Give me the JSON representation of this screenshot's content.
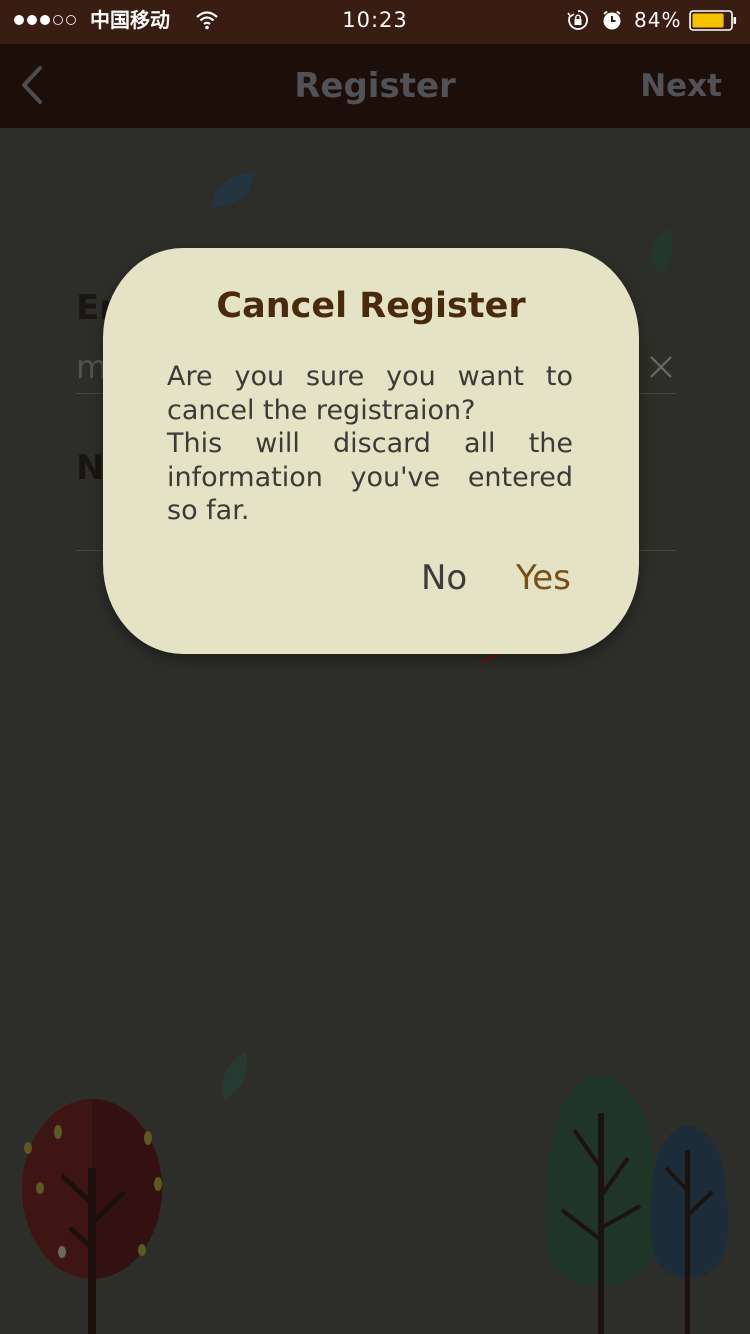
{
  "status_bar": {
    "carrier": "中国移动",
    "time": "10:23",
    "battery_percent": "84%",
    "signal_icon": "signal-dots-icon",
    "wifi_icon": "wifi-icon",
    "orientation_lock_icon": "rotation-lock-icon",
    "alarm_icon": "alarm-clock-icon",
    "battery_icon": "battery-icon",
    "battery_level": 0.84,
    "battery_color": "#f6c200"
  },
  "nav": {
    "back_icon": "chevron-left-icon",
    "title": "Register",
    "next_label": "Next"
  },
  "form": {
    "email_label": "Em",
    "email_value": "m",
    "clear_icon": "close-icon",
    "name_label": "N"
  },
  "dialog": {
    "title": "Cancel Register",
    "message_line1": "Are you sure you want to cancel the registraion?",
    "message_line2": "This will discard all the information you've entered so far.",
    "no_label": "No",
    "yes_label": "Yes"
  },
  "colors": {
    "status_bar_bg": "#3a1d12",
    "nav_bg": "#1c0f0a",
    "page_bg": "#2d2e2a",
    "dialog_bg": "#e4e3c5",
    "dialog_title": "#4a2a0c",
    "yes_accent": "#7a4e15"
  }
}
